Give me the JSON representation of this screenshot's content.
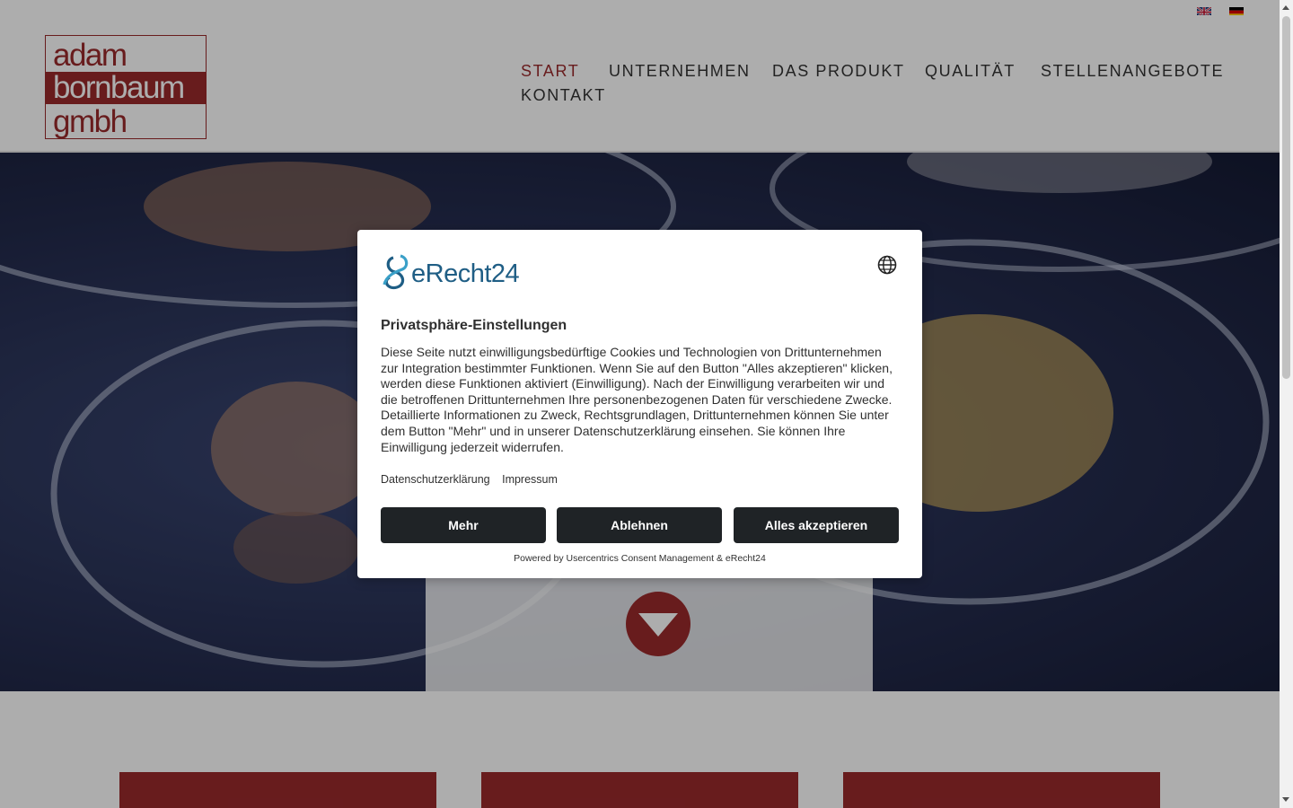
{
  "languages": [
    {
      "icon": "uk-flag-icon",
      "label": "English"
    },
    {
      "icon": "de-flag-icon",
      "label": "Deutsch"
    }
  ],
  "logo": {
    "line1": "adam",
    "line2": "bornbaum",
    "line3": "gmbh"
  },
  "nav": {
    "items": [
      {
        "label": "START",
        "active": true
      },
      {
        "label": "UNTERNEHMEN",
        "active": false
      },
      {
        "label": "DAS PRODUKT",
        "active": false
      },
      {
        "label": "QUALITÄT",
        "active": false
      },
      {
        "label": "STELLENANGEBOTE",
        "active": false
      },
      {
        "label": "KONTAKT",
        "active": false
      }
    ]
  },
  "hero": {
    "scroll_icon": "chevron-down-icon"
  },
  "consent": {
    "brand": "eRecht24",
    "title": "Privatsphäre-Einstellungen",
    "body": "Diese Seite nutzt einwilligungsbedürftige Cookies und Technologien von Drittunternehmen zur Integration bestimmter Funktionen. Wenn Sie auf den Button \"Alles akzeptieren\" klicken, werden diese Funktionen aktiviert (Einwilligung). Nach der Einwilligung verarbeiten wir und die betroffenen Drittunternehmen Ihre personenbezogenen Daten für verschiedene Zwecke. Detaillierte Informationen zu Zweck, Rechtsgrundlagen, Drittunternehmen können Sie unter dem Button \"Mehr\" und in unserer Datenschutzerklärung einsehen. Sie können Ihre Einwilligung jederzeit widerrufen.",
    "links": {
      "privacy": "Datenschutzerklärung",
      "imprint": "Impressum"
    },
    "buttons": {
      "more": "Mehr",
      "decline": "Ablehnen",
      "accept_all": "Alles akzeptieren"
    },
    "powered_by": "Powered by Usercentrics Consent Management & eRecht24",
    "language_icon": "globe-icon"
  },
  "colors": {
    "brand": "#9a2a2c",
    "button": "#1f2326",
    "consent_logo": "#1f5e85"
  }
}
